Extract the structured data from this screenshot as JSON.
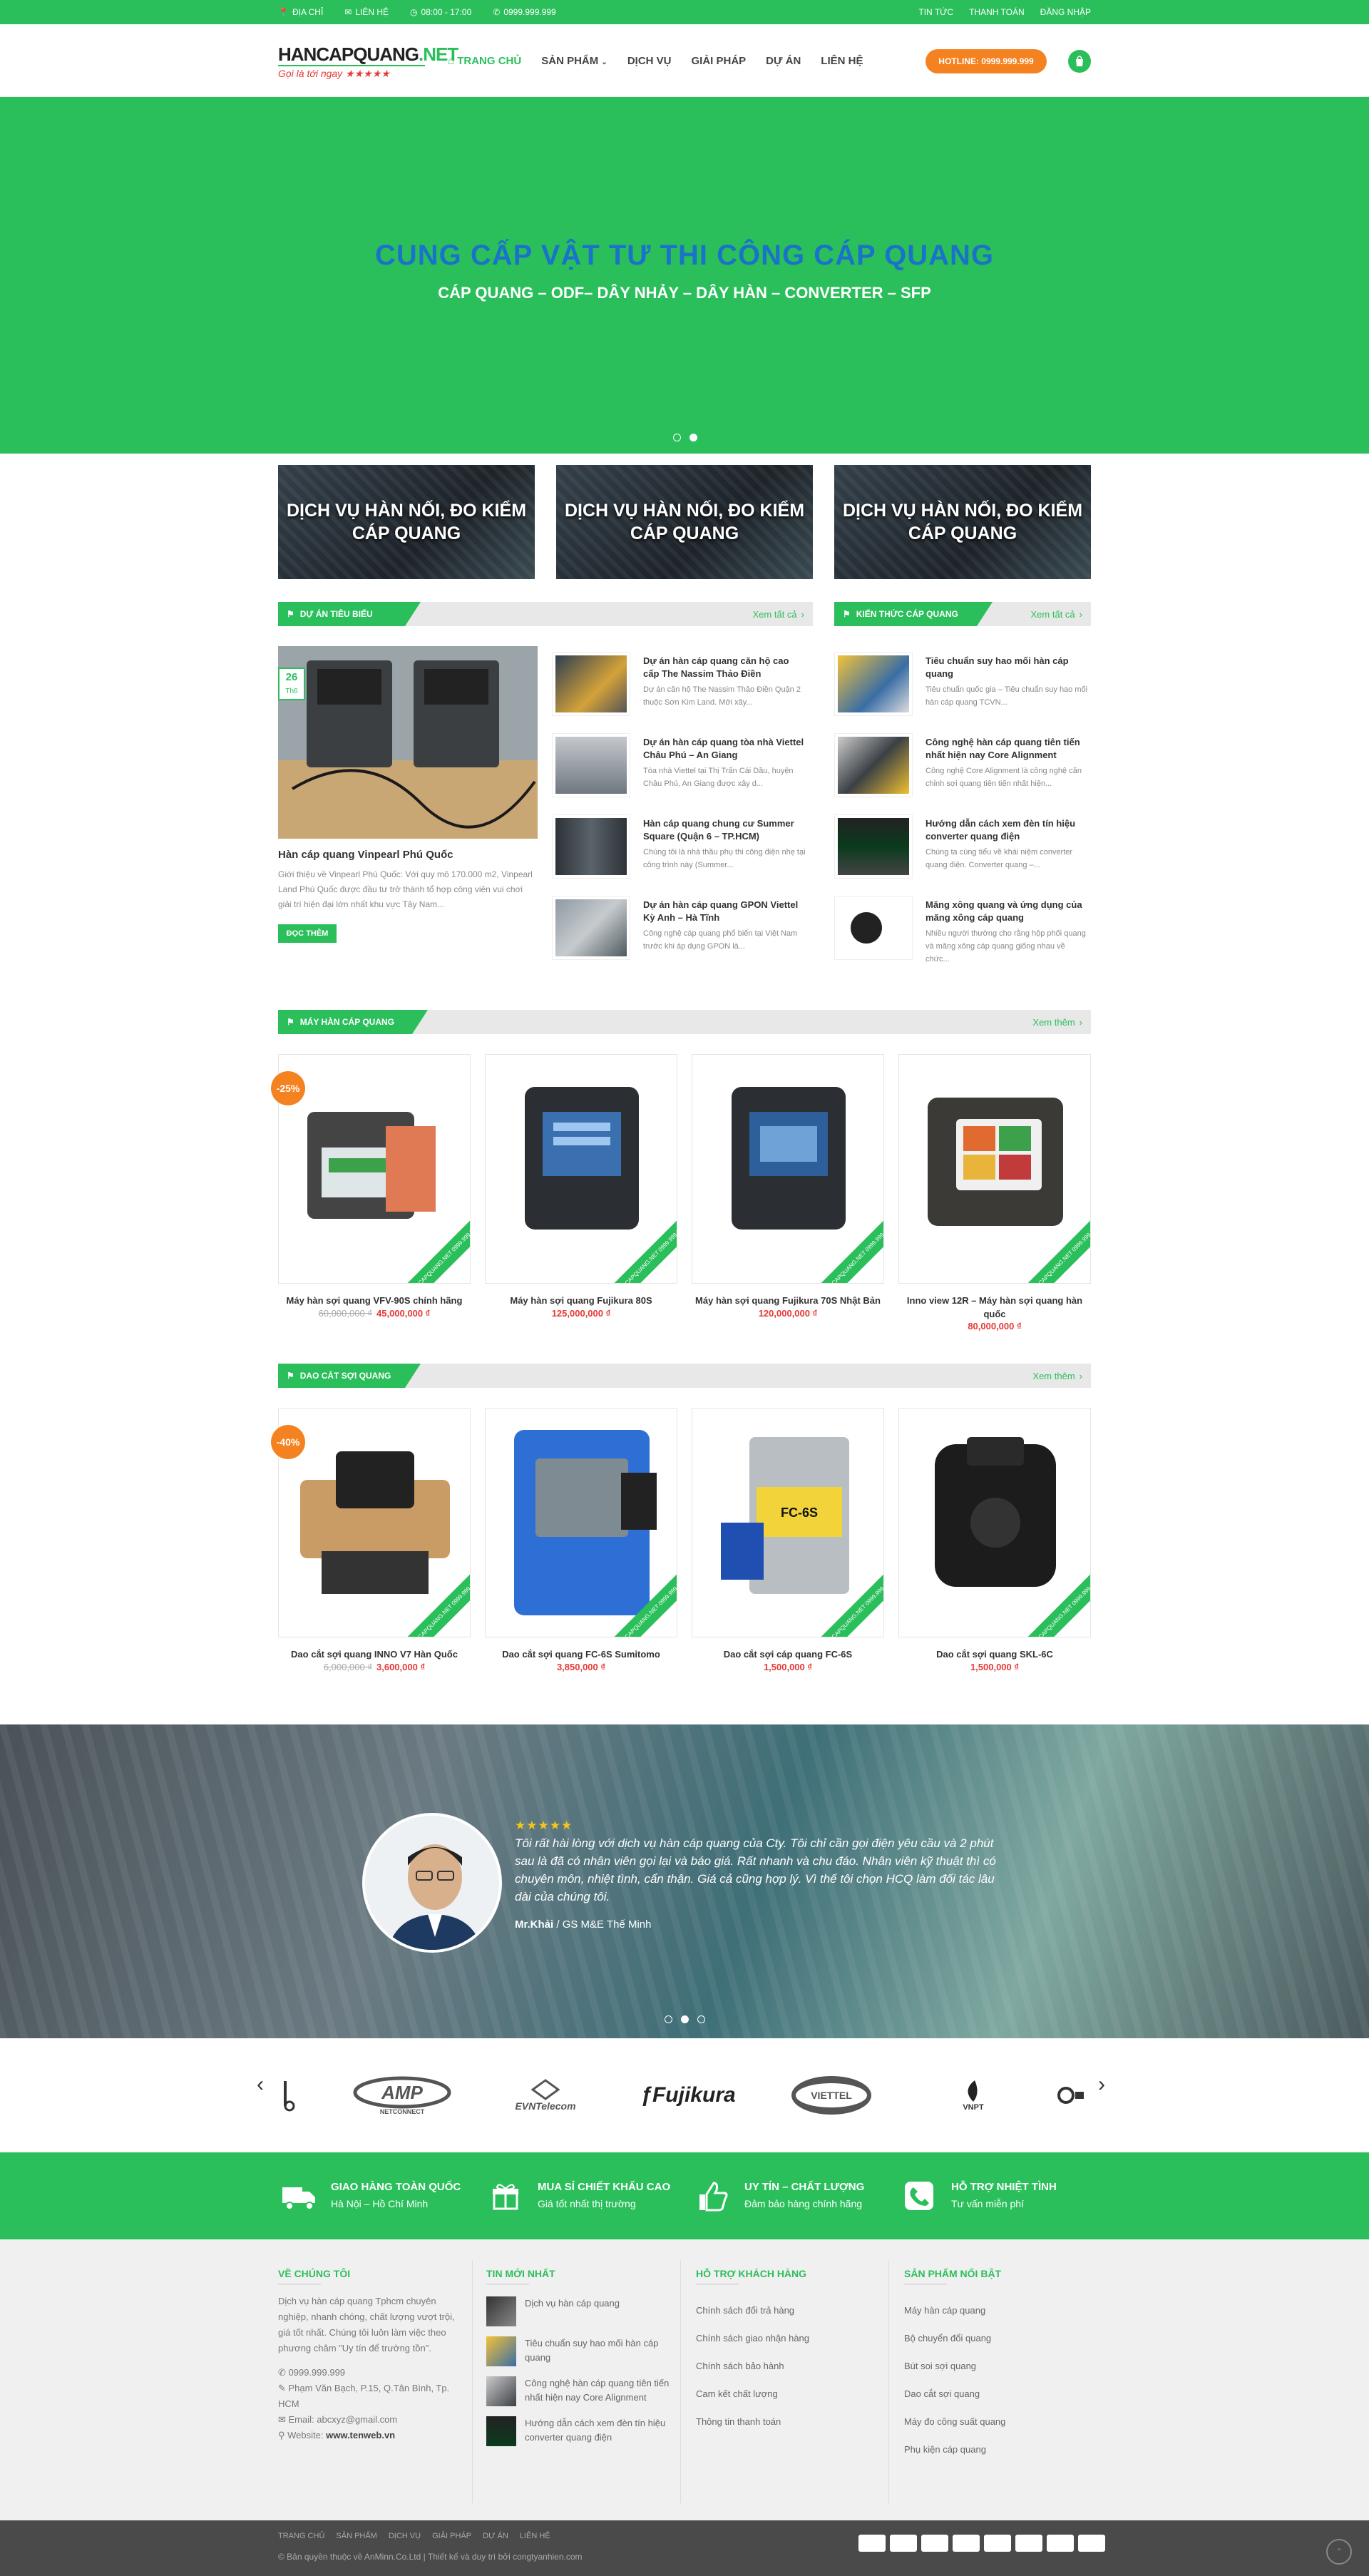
{
  "topbar": {
    "address": "ĐỊA CHỈ",
    "contact": "LIÊN HỆ",
    "hours": "08:00 - 17:00",
    "phone": "0999.999.999",
    "news": "TIN TỨC",
    "payment": "THANH TOÁN",
    "login": "ĐĂNG NHẬP"
  },
  "header": {
    "logo_main": "HANCAPQUANG",
    "logo_ext": ".NET",
    "logo_slogan": "Gọi là tới ngay ★★★★★",
    "nav": [
      "TRANG CHỦ",
      "SẢN PHẨM",
      "DỊCH VỤ",
      "GIẢI PHÁP",
      "DỰ ÁN",
      "LIÊN HỆ"
    ],
    "hotline": "HOTLINE: 0999.999.999"
  },
  "hero": {
    "title": "CUNG CẤP VẬT TƯ THI CÔNG CÁP QUANG",
    "subtitle": "CÁP QUANG – ODF– DÂY NHẢY – DÂY HÀN – CONVERTER – SFP"
  },
  "services": [
    "DỊCH VỤ HÀN NỐI, ĐO KIỂM CÁP QUANG",
    "DỊCH VỤ HÀN NỐI, ĐO KIỂM CÁP QUANG",
    "DỊCH VỤ HÀN NỐI, ĐO KIỂM CÁP QUANG"
  ],
  "projects": {
    "heading": "DỰ ÁN TIÊU BIỂU",
    "more": "Xem tất cả",
    "featured": {
      "day": "26",
      "month": "Th6",
      "title": "Hàn cáp quang Vinpearl Phú Quốc",
      "text": "Giới thiệu về Vinpearl Phú Quốc: Với quy mô 170.000 m2, Vinpearl Land Phú Quốc được đầu tư trở thành tổ hợp công viên vui chơi giải trí hiện đại lớn nhất khu vực Tây Nam...",
      "button": "ĐỌC THÊM"
    },
    "list": [
      {
        "title": "Dự án hàn cáp quang căn hộ cao cấp The Nassim Thảo Điền",
        "desc": "Dự án căn hộ The Nassim Thảo Điền Quận 2 thuộc Sơn Kim Land. Mới xây..."
      },
      {
        "title": "Dự án hàn cáp quang tòa nhà Viettel Châu Phú – An Giang",
        "desc": "Tòa nhà Viettel tại Thị Trấn Cái Dầu, huyện Châu Phú, An Giang được xây d..."
      },
      {
        "title": "Hàn cáp quang chung cư Summer Square (Quận 6 – TP.HCM)",
        "desc": "Chúng tôi là nhà thầu phụ thi công điện nhẹ tại công trình này (Summer..."
      },
      {
        "title": "Dự án hàn cáp quang GPON Viettel Kỳ Anh – Hà Tĩnh",
        "desc": "Công nghệ cáp quang phổ biến tại Việt Nam trước khi áp dụng GPON là..."
      }
    ]
  },
  "knowledge": {
    "heading": "KIẾN THỨC CÁP QUANG",
    "more": "Xem tất cả",
    "list": [
      {
        "title": "Tiêu chuẩn suy hao mối hàn cáp quang",
        "desc": "Tiêu chuẩn quốc gia – Tiêu chuẩn suy hao mối hàn cáp quang TCVN..."
      },
      {
        "title": "Công nghệ hàn cáp quang tiên tiến nhất hiện nay Core Alignment",
        "desc": "Công nghệ Core Alignment là công nghệ căn chỉnh sợi quang tiên tiến nhất hiện..."
      },
      {
        "title": "Hướng dẫn cách xem đèn tín hiệu converter quang điện",
        "desc": "Chúng ta cùng tiểu về khái niệm converter quang điện. Converter quang –..."
      },
      {
        "title": "Măng xông quang và ứng dụng của măng xông cáp quang",
        "desc": "Nhiều người thường cho rằng hộp phối quang và măng xông cáp quang giống nhau về chức..."
      }
    ]
  },
  "splicers": {
    "heading": "MÁY HÀN CÁP QUANG",
    "more": "Xem thêm",
    "items": [
      {
        "name": "Máy hàn sợi quang VFV-90S chính hãng",
        "old": "60,000,000 ₫",
        "price": "45,000,000 ₫",
        "badge": "-25%"
      },
      {
        "name": "Máy hàn sợi quang Fujikura 80S",
        "old": "",
        "price": "125,000,000 ₫",
        "badge": ""
      },
      {
        "name": "Máy hàn sợi quang Fujikura 70S Nhật Bản",
        "old": "",
        "price": "120,000,000 ₫",
        "badge": ""
      },
      {
        "name": "Inno view 12R – Máy hàn sợi quang hàn quốc",
        "old": "",
        "price": "80,000,000 ₫",
        "badge": ""
      }
    ]
  },
  "cleavers": {
    "heading": "DAO CẮT SỢI QUANG",
    "more": "Xem thêm",
    "items": [
      {
        "name": "Dao cắt sợi quang INNO V7 Hàn Quốc",
        "old": "6,000,000 ₫",
        "price": "3,600,000 ₫",
        "badge": "-40%"
      },
      {
        "name": "Dao cắt sợi quang FC-6S Sumitomo",
        "old": "",
        "price": "3,850,000 ₫",
        "badge": ""
      },
      {
        "name": "Dao cắt sợi cáp quang FC-6S",
        "old": "",
        "price": "1,500,000 ₫",
        "badge": ""
      },
      {
        "name": "Dao cắt sợi quang SKL-6C",
        "old": "",
        "price": "1,500,000 ₫",
        "badge": ""
      }
    ]
  },
  "ribbon_text": "HANCAPQUANG.NET 0999.999.999",
  "testimonial": {
    "stars": "★★★★★",
    "quote": "Tôi rất hài lòng với dịch vụ hàn cáp quang của Cty. Tôi chỉ cần gọi điện yêu cầu và 2 phút sau là đã có nhân viên gọi lại và báo giá. Rất nhanh và chu đáo. Nhân viên kỹ thuật thì có chuyên môn, nhiệt tình, cẩn thận. Giá cả cũng hợp lý. Vì thế tôi chọn HCQ làm đối tác lâu dài của chúng tôi.",
    "name": "Mr.Khải",
    "role": " / GS M&E Thế Minh"
  },
  "partners": [
    "AMP NETCONNECT",
    "EVNTelecom",
    "Fujikura",
    "VIETTEL",
    "VNPT"
  ],
  "features": [
    {
      "title": "GIAO HÀNG TOÀN QUỐC",
      "sub": "Hà Nội – Hồ Chí Minh",
      "icon": "truck-icon"
    },
    {
      "title": "MUA SỈ CHIẾT KHẤU CAO",
      "sub": "Giá tốt nhất thị trường",
      "icon": "gift-icon"
    },
    {
      "title": "UY TÍN – CHẤT LƯỢNG",
      "sub": "Đảm bảo hàng chính hãng",
      "icon": "thumbs-up-icon"
    },
    {
      "title": "HỖ TRỢ NHIỆT TÌNH",
      "sub": "Tư vấn miễn phí",
      "icon": "phone-icon"
    }
  ],
  "footer": {
    "about_title": "VỀ CHÚNG TÔI",
    "about_text": "Dịch vụ hàn cáp quang Tphcm chuyên nghiệp, nhanh chóng, chất lượng vượt trội, giá tốt nhất. Chúng tôi luôn làm việc theo phương châm \"Uy tín để trường tồn\".",
    "phone": "0999.999.999",
    "address": "Phạm Văn Bạch, P.15, Q.Tân Bình, Tp. HCM",
    "email": "Email: abcxyz@gmail.com",
    "website_label": "Website: ",
    "website": "www.tenweb.vn",
    "news_title": "TIN MỚI NHẤT",
    "news": [
      "Dịch vụ hàn cáp quang",
      "Tiêu chuẩn suy hao mối hàn cáp quang",
      "Công nghệ hàn cáp quang tiên tiến nhất hiện nay Core Alignment",
      "Hướng dẫn cách xem đèn tín hiệu converter quang điện"
    ],
    "support_title": "HỖ TRỢ KHÁCH HÀNG",
    "support": [
      "Chính sách đổi trả hàng",
      "Chính sách giao nhận hàng",
      "Chính sách bảo hành",
      "Cam kết chất lượng",
      "Thông tin thanh toán"
    ],
    "products_title": "SẢN PHẨM NỔI BẬT",
    "products": [
      "Máy hàn cáp quang",
      "Bộ chuyển đổi quang",
      "Bút soi sợi quang",
      "Dao cắt sợi quang",
      "Máy đo công suất quang",
      "Phụ kiện cáp quang"
    ]
  },
  "bottom": {
    "menu": [
      "TRANG CHỦ",
      "SẢN PHẨM",
      "DỊCH VỤ",
      "GIẢI PHÁP",
      "DỰ ÁN",
      "LIÊN HỆ"
    ],
    "copyright": "© Bản quyền thuộc về AnMinn.Co.Ltd",
    "design": "Thiết kế và duy trì bởi congtyanhien.com"
  }
}
